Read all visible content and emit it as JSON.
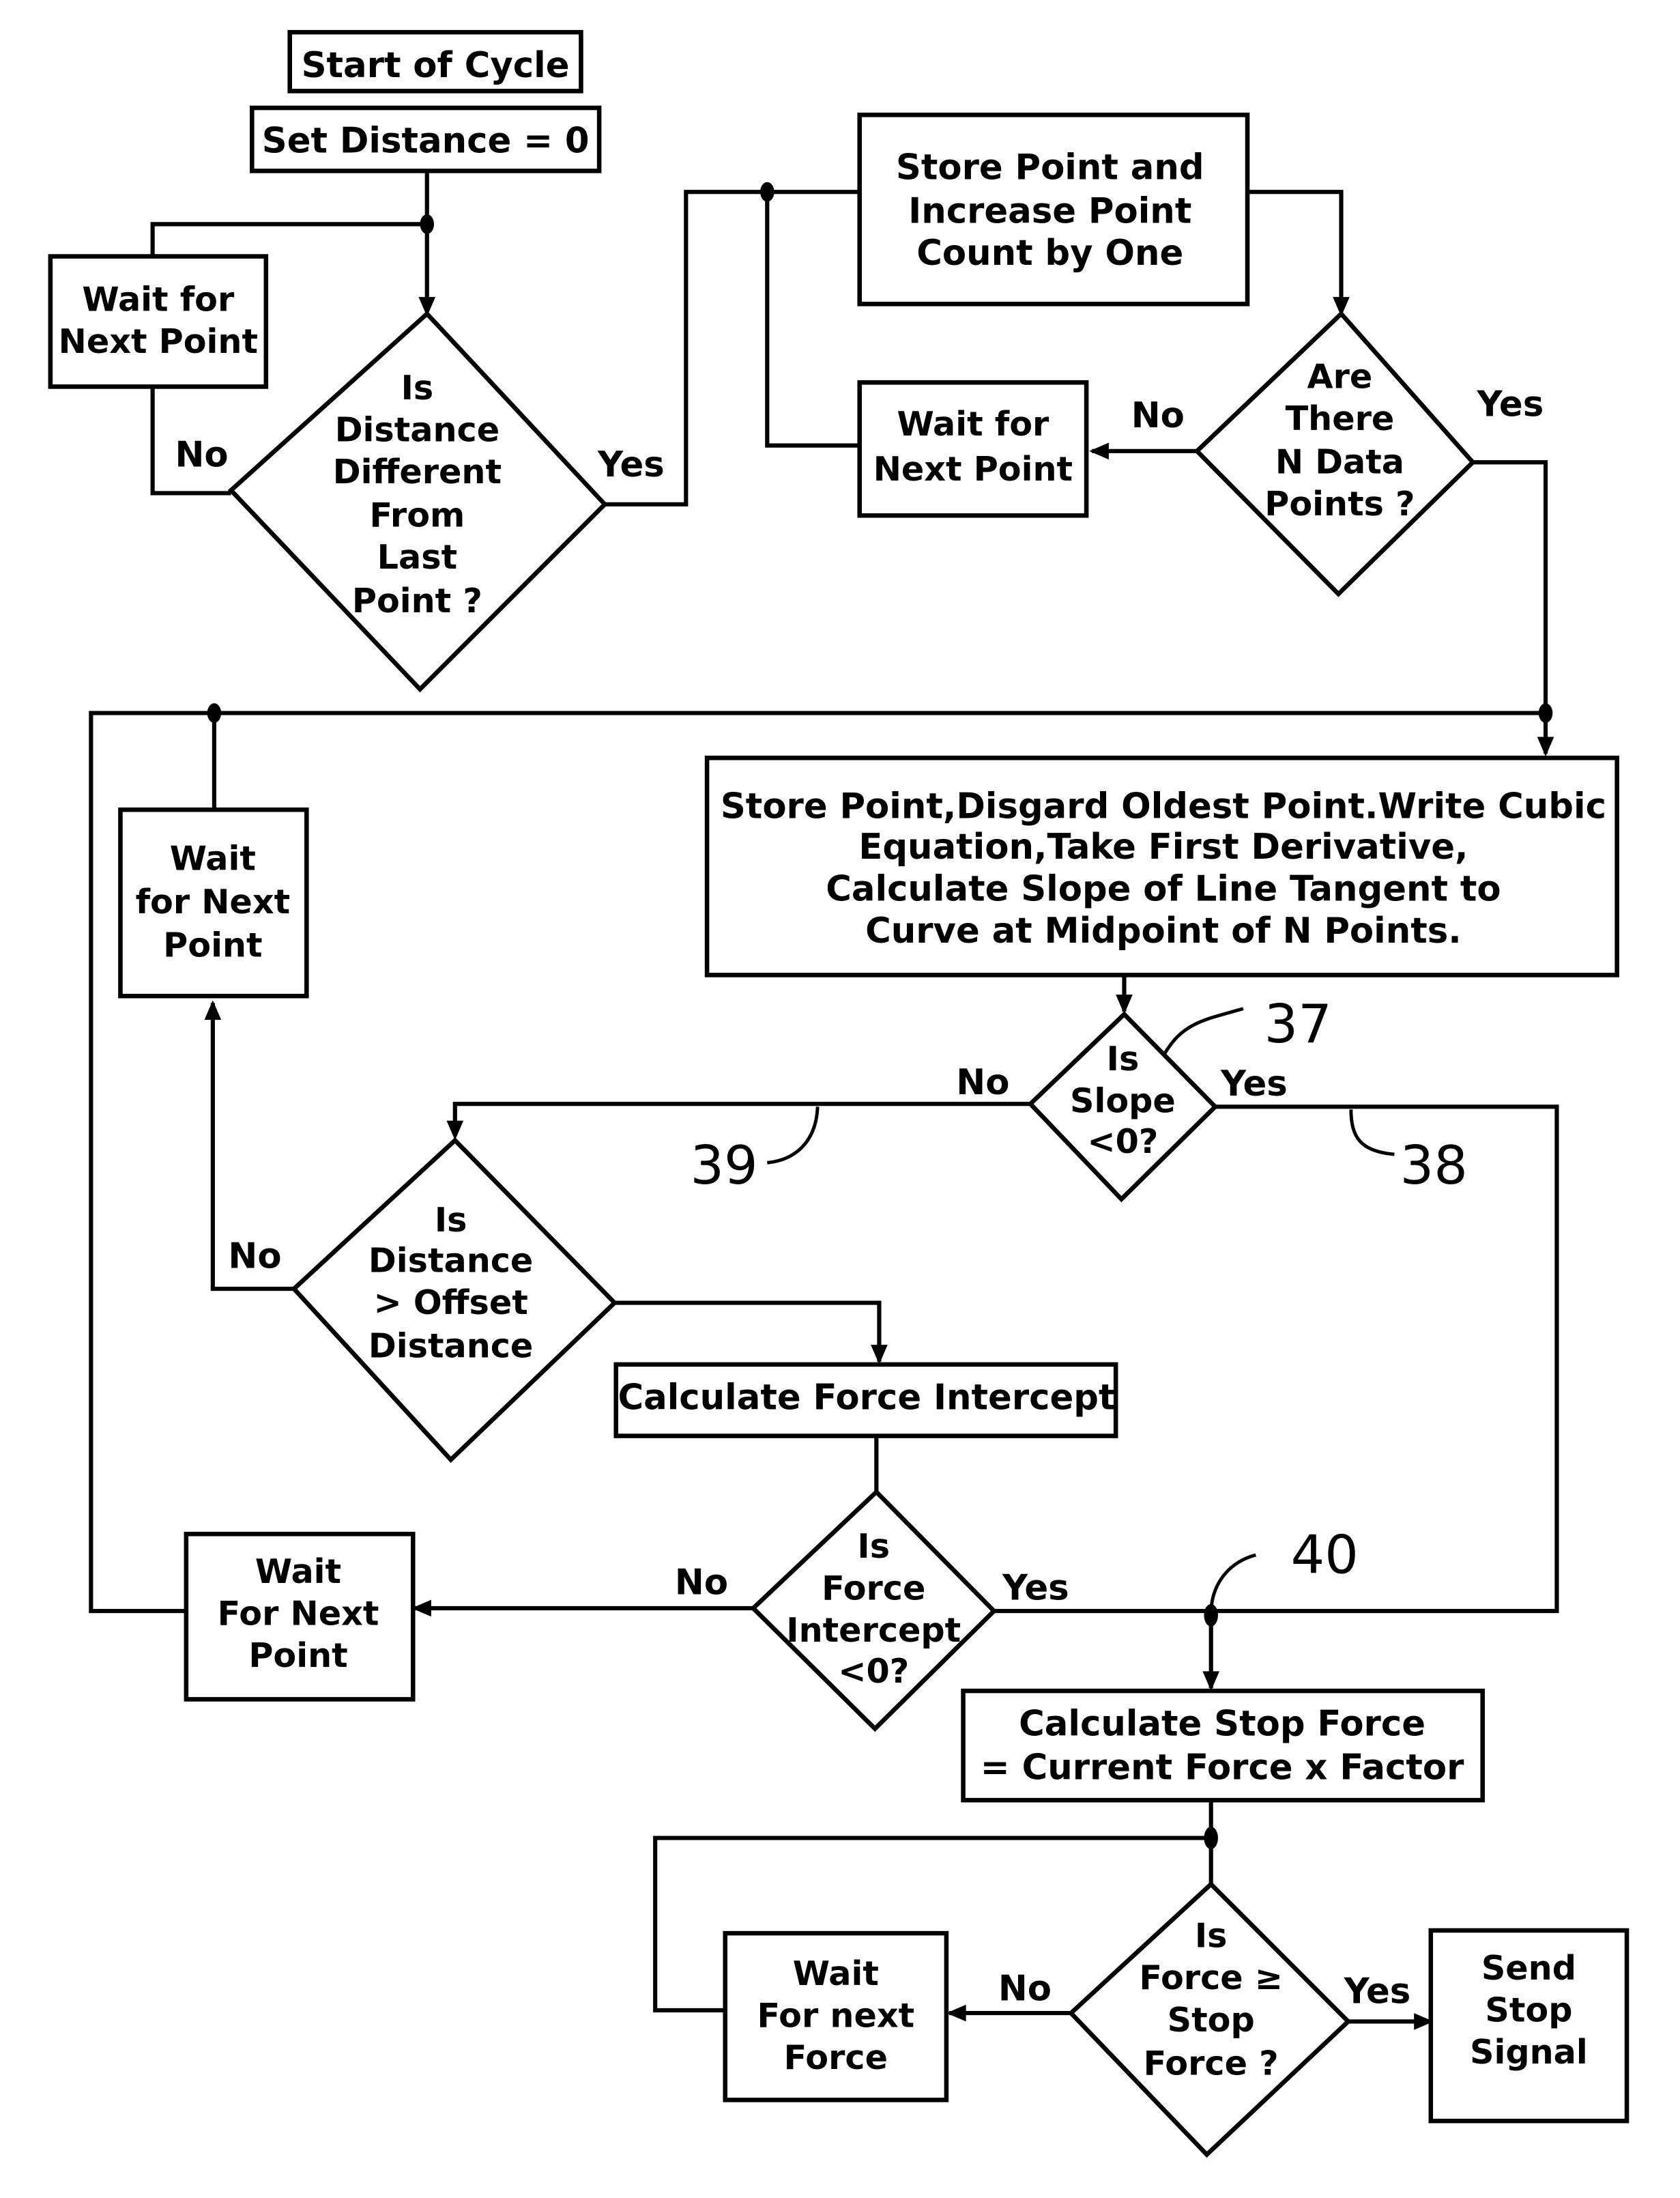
{
  "diagram": {
    "type": "flowchart",
    "nodes": {
      "start": {
        "kind": "terminal",
        "lines": [
          "Start of Cycle"
        ]
      },
      "set_distance": {
        "kind": "process",
        "lines": [
          "Set Distance = 0"
        ]
      },
      "wait_1": {
        "kind": "process",
        "lines": [
          "Wait for",
          "Next Point"
        ]
      },
      "dec_distance_diff": {
        "kind": "decision",
        "lines": [
          "Is",
          "Distance",
          "Different",
          "From",
          "Last",
          "Point ?"
        ]
      },
      "store_point": {
        "kind": "process",
        "lines": [
          "Store Point and",
          "Increase Point",
          "Count by One"
        ]
      },
      "wait_2": {
        "kind": "process",
        "lines": [
          "Wait for",
          "Next Point"
        ]
      },
      "dec_n_points": {
        "kind": "decision",
        "lines": [
          "Are",
          "There",
          "N Data",
          "Points ?"
        ]
      },
      "cubic": {
        "kind": "process",
        "lines": [
          "Store Point,Disgard Oldest Point.Write Cubic",
          "Equation,Take First Derivative,",
          "Calculate Slope of Line Tangent to",
          "Curve at Midpoint of N Points."
        ]
      },
      "wait_3": {
        "kind": "process",
        "lines": [
          "Wait",
          "for Next",
          "Point"
        ]
      },
      "dec_slope": {
        "kind": "decision",
        "lines": [
          "Is",
          "Slope",
          "<0?"
        ]
      },
      "dec_offset": {
        "kind": "decision",
        "lines": [
          "Is",
          "Distance",
          "> Offset",
          "Distance"
        ]
      },
      "calc_intercept": {
        "kind": "process",
        "lines": [
          "Calculate Force Intercept"
        ]
      },
      "dec_intercept": {
        "kind": "decision",
        "lines": [
          "Is",
          "Force",
          "Intercept",
          "<0?"
        ]
      },
      "wait_4": {
        "kind": "process",
        "lines": [
          "Wait",
          "For Next",
          "Point"
        ]
      },
      "calc_stop": {
        "kind": "process",
        "lines": [
          "Calculate Stop Force",
          "= Current Force x Factor"
        ]
      },
      "dec_force": {
        "kind": "decision",
        "lines": [
          "Is",
          "Force ≥",
          "Stop",
          "Force ?"
        ]
      },
      "wait_5": {
        "kind": "process",
        "lines": [
          "Wait",
          "For next",
          "Force"
        ]
      },
      "send_stop": {
        "kind": "terminal",
        "lines": [
          "Send",
          "Stop",
          "Signal"
        ]
      }
    },
    "edge_labels": {
      "no_1": "No",
      "yes_1": "Yes",
      "no_2": "No",
      "yes_2": "Yes",
      "no_3": "No",
      "yes_3": "Yes",
      "no_4": "No",
      "no_5": "No",
      "yes_5": "Yes",
      "no_6": "No",
      "yes_6": "Yes"
    },
    "reference_numerals": {
      "r37": "37",
      "r38": "38",
      "r39": "39",
      "r40": "40"
    }
  }
}
